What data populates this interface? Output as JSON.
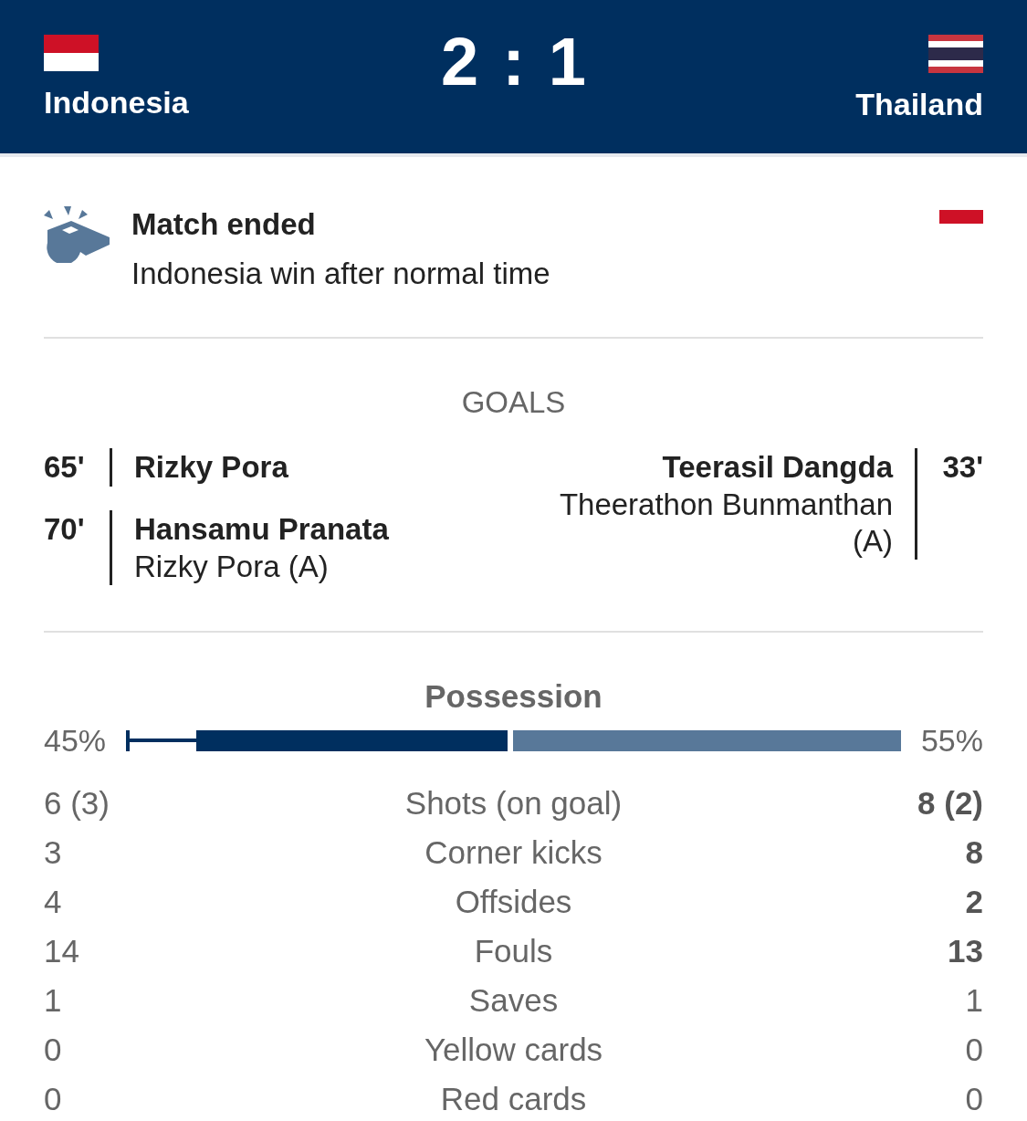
{
  "header": {
    "home": {
      "name": "Indonesia"
    },
    "away": {
      "name": "Thailand"
    },
    "score": {
      "home": "2",
      "separator": ":",
      "away": "1"
    }
  },
  "status": {
    "title": "Match ended",
    "subtitle": "Indonesia win after normal time"
  },
  "goals": {
    "title": "GOALS",
    "home": [
      {
        "minute": "65'",
        "scorer": "Rizky Pora"
      },
      {
        "minute": "70'",
        "scorer": "Hansamu Pranata",
        "assist": "Rizky Pora (A)"
      }
    ],
    "away": [
      {
        "minute": "33'",
        "scorer": "Teerasil Dangda",
        "assist": "Theerathon Bunmanthan (A)"
      }
    ]
  },
  "possession": {
    "title": "Possession",
    "home_reading": "45%",
    "away_reading": "55%",
    "level": 0.45
  },
  "stats": [
    {
      "label": "Shots (on goal)",
      "home": "6 (3)",
      "away": "8 (2)",
      "home_highlighted": false,
      "away_highlighted": true
    },
    {
      "label": "Corner kicks",
      "home": "3",
      "away": "8",
      "home_highlighted": false,
      "away_highlighted": true
    },
    {
      "label": "Offsides",
      "home": "4",
      "away": "2",
      "home_highlighted": false,
      "away_highlighted": true
    },
    {
      "label": "Fouls",
      "home": "14",
      "away": "13",
      "home_highlighted": false,
      "away_highlighted": true
    },
    {
      "label": "Saves",
      "home": "1",
      "away": "1",
      "home_highlighted": false,
      "away_highlighted": false
    },
    {
      "label": "Yellow cards",
      "home": "0",
      "away": "0",
      "home_highlighted": false,
      "away_highlighted": false
    },
    {
      "label": "Red cards",
      "home": "0",
      "away": "0",
      "home_highlighted": false,
      "away_highlighted": false
    }
  ]
}
